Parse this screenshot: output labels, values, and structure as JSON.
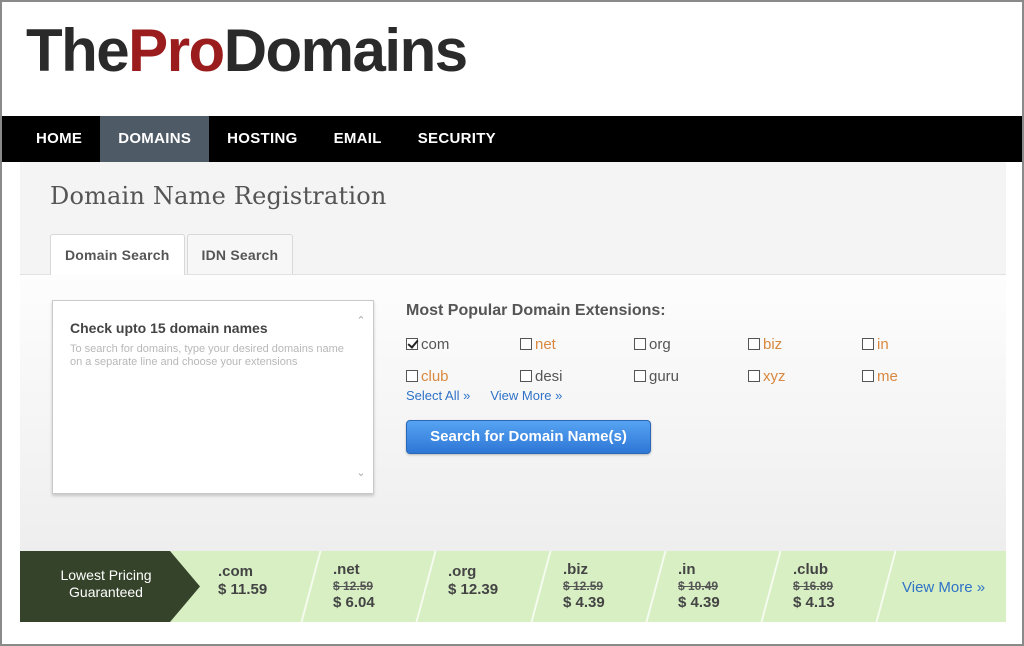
{
  "logo": {
    "part1": "The",
    "part2": "Pro",
    "part3": "Domains"
  },
  "nav": {
    "items": [
      {
        "label": "HOME"
      },
      {
        "label": "DOMAINS",
        "active": true
      },
      {
        "label": "HOSTING"
      },
      {
        "label": "EMAIL"
      },
      {
        "label": "SECURITY"
      }
    ]
  },
  "page": {
    "title": "Domain Name Registration"
  },
  "tabs": [
    {
      "label": "Domain Search",
      "active": true
    },
    {
      "label": "IDN Search"
    }
  ],
  "search_box": {
    "title": "Check upto 15 domain names",
    "hint": "To search for domains, type your desired domains name on a separate line and choose your extensions"
  },
  "extensions": {
    "heading": "Most Popular Domain Extensions:",
    "rows": [
      [
        {
          "label": "com",
          "checked": true,
          "color": "#555555"
        },
        {
          "label": "net",
          "checked": false,
          "color": "#d9883f"
        },
        {
          "label": "org",
          "checked": false,
          "color": "#555555"
        },
        {
          "label": "biz",
          "checked": false,
          "color": "#d9883f"
        },
        {
          "label": "in",
          "checked": false,
          "color": "#d9883f"
        }
      ],
      [
        {
          "label": "club",
          "checked": false,
          "color": "#d9883f"
        },
        {
          "label": "desi",
          "checked": false,
          "color": "#555555"
        },
        {
          "label": "guru",
          "checked": false,
          "color": "#555555"
        },
        {
          "label": "xyz",
          "checked": false,
          "color": "#d9883f"
        },
        {
          "label": "me",
          "checked": false,
          "color": "#d9883f"
        }
      ]
    ],
    "select_all": "Select All »",
    "view_more": "View More »",
    "search_button": "Search for Domain Name(s)"
  },
  "pricing": {
    "badge_line1": "Lowest Pricing",
    "badge_line2": "Guaranteed",
    "items": [
      {
        "ext": ".com",
        "old": "",
        "price": "$ 11.59"
      },
      {
        "ext": ".net",
        "old": "$ 12.59",
        "price": "$ 6.04"
      },
      {
        "ext": ".org",
        "old": "",
        "price": "$ 12.39"
      },
      {
        "ext": ".biz",
        "old": "$ 12.59",
        "price": "$ 4.39"
      },
      {
        "ext": ".in",
        "old": "$ 10.49",
        "price": "$ 4.39"
      },
      {
        "ext": ".club",
        "old": "$ 16.89",
        "price": "$ 4.13"
      }
    ],
    "view_more": "View More »"
  },
  "colors": {
    "nav_bg": "#000000",
    "nav_active": "#4e5a66",
    "logo_accent": "#9b1c1c",
    "link": "#2f72c7",
    "pricing_bg": "#d7efc3",
    "badge_bg": "#34432a"
  }
}
